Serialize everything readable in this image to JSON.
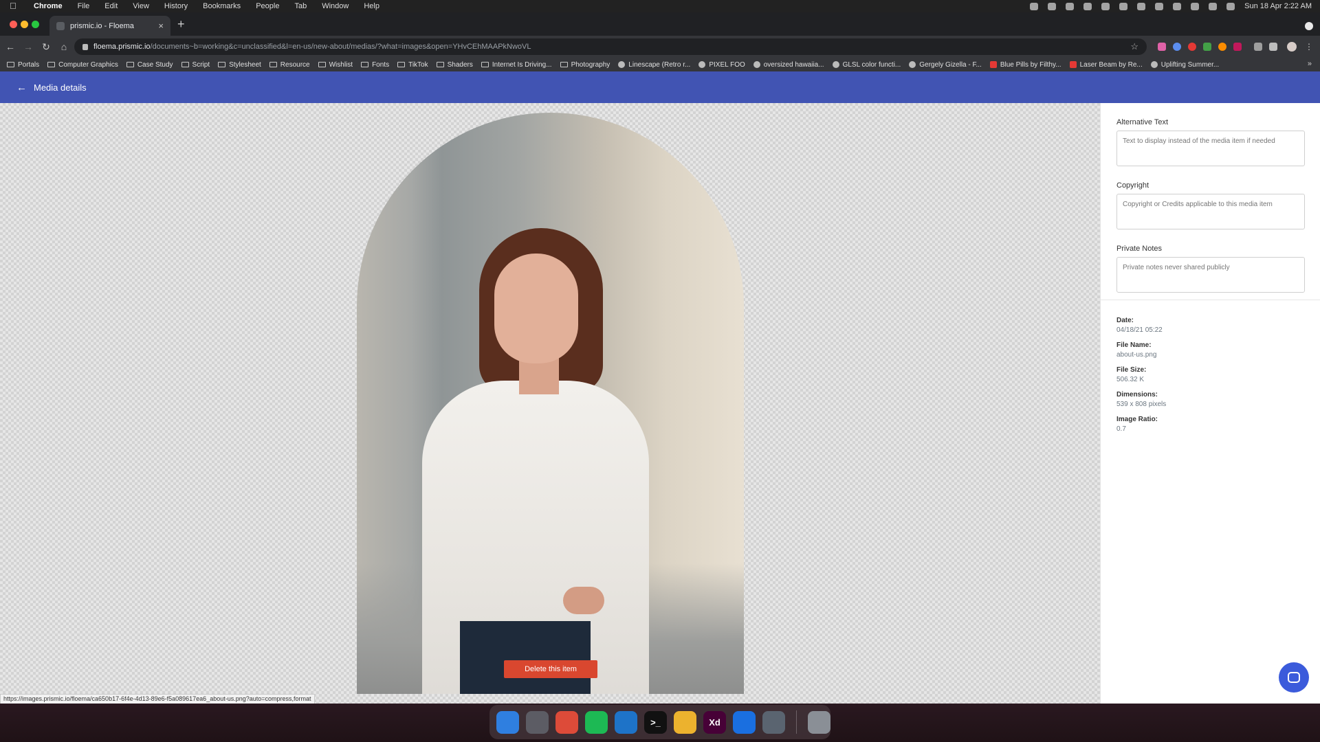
{
  "menubar": {
    "app_name": "Chrome",
    "items": [
      "File",
      "Edit",
      "View",
      "History",
      "Bookmarks",
      "People",
      "Tab",
      "Window",
      "Help"
    ],
    "clock": "Sun 18 Apr  2:22 AM"
  },
  "browser": {
    "tab_title": "prismic.io - Floema",
    "url_host": "floema.prismic.io",
    "url_path": "/documents~b=working&c=unclassified&l=en-us/new-about/medias/?what=images&open=YHvCEhMAAPkNwoVL",
    "bookmarks": [
      {
        "label": "Portals",
        "icon": "folder-icon"
      },
      {
        "label": "Computer Graphics",
        "icon": "folder-icon"
      },
      {
        "label": "Case Study",
        "icon": "folder-icon"
      },
      {
        "label": "Script",
        "icon": "folder-icon"
      },
      {
        "label": "Stylesheet",
        "icon": "folder-icon"
      },
      {
        "label": "Resource",
        "icon": "folder-icon"
      },
      {
        "label": "Wishlist",
        "icon": "folder-icon"
      },
      {
        "label": "Fonts",
        "icon": "folder-icon"
      },
      {
        "label": "TikTok",
        "icon": "folder-icon"
      },
      {
        "label": "Shaders",
        "icon": "folder-icon"
      },
      {
        "label": "Internet Is Driving...",
        "icon": "folder-icon"
      },
      {
        "label": "Photography",
        "icon": "folder-icon"
      },
      {
        "label": "Linescape (Retro r...",
        "icon": "site-icon"
      },
      {
        "label": "PIXEL FOO",
        "icon": "site-icon"
      },
      {
        "label": "oversized hawaiia...",
        "icon": "site-icon"
      },
      {
        "label": "GLSL color functi...",
        "icon": "github-icon"
      },
      {
        "label": "Gergely Gizella - F...",
        "icon": "site-icon"
      },
      {
        "label": "Blue Pills by Filthy...",
        "icon": "site-icon"
      },
      {
        "label": "Laser Beam by Re...",
        "icon": "site-icon"
      },
      {
        "label": "Uplifting Summer...",
        "icon": "site-icon"
      }
    ],
    "bookmarks_more": "»",
    "status_url": "https://images.prismic.io/floema/ca650b17-6f4e-4d13-89e6-f5a089617ea6_about-us.png?auto=compress,format"
  },
  "header": {
    "back_icon": "arrow-left-icon",
    "title": "Media details"
  },
  "preview": {
    "delete_label": "Delete this item"
  },
  "sidebar": {
    "alt_text": {
      "label": "Alternative Text",
      "placeholder": "Text to display instead of the media item if needed",
      "value": ""
    },
    "copyright": {
      "label": "Copyright",
      "placeholder": "Copyright or Credits applicable to this media item",
      "value": ""
    },
    "private_notes": {
      "label": "Private Notes",
      "placeholder": "Private notes never shared publicly",
      "value": ""
    },
    "meta": [
      {
        "key": "Date:",
        "value": "04/18/21 05:22"
      },
      {
        "key": "File Name:",
        "value": "about-us.png"
      },
      {
        "key": "File Size:",
        "value": "506.32 K"
      },
      {
        "key": "Dimensions:",
        "value": "539 x 808 pixels"
      },
      {
        "key": "Image Ratio:",
        "value": "0.7"
      }
    ]
  },
  "dock": {
    "apps": [
      {
        "name": "finder-icon",
        "color": "#2f7fe0",
        "glyph": ""
      },
      {
        "name": "launchpad-icon",
        "color": "#5c5c64",
        "glyph": ""
      },
      {
        "name": "chrome-icon",
        "color": "#dd4b39",
        "glyph": ""
      },
      {
        "name": "spotify-icon",
        "color": "#1db954",
        "glyph": ""
      },
      {
        "name": "vscode-icon",
        "color": "#1e73c8",
        "glyph": ""
      },
      {
        "name": "terminal-icon",
        "color": "#111111",
        "glyph": ">_"
      },
      {
        "name": "slack-icon",
        "color": "#ecb22e",
        "glyph": ""
      },
      {
        "name": "adobe-xd-icon",
        "color": "#470137",
        "glyph": "Xd"
      },
      {
        "name": "maps-pin-icon",
        "color": "#1a6fe0",
        "glyph": ""
      },
      {
        "name": "app-icon",
        "color": "#5a6470",
        "glyph": ""
      }
    ],
    "trash": {
      "name": "trash-icon",
      "color": "#8a8f96"
    }
  },
  "colors": {
    "header_bg": "#4154b3",
    "delete_bg": "#d9472f",
    "chat_bg": "#3b5bdb"
  }
}
